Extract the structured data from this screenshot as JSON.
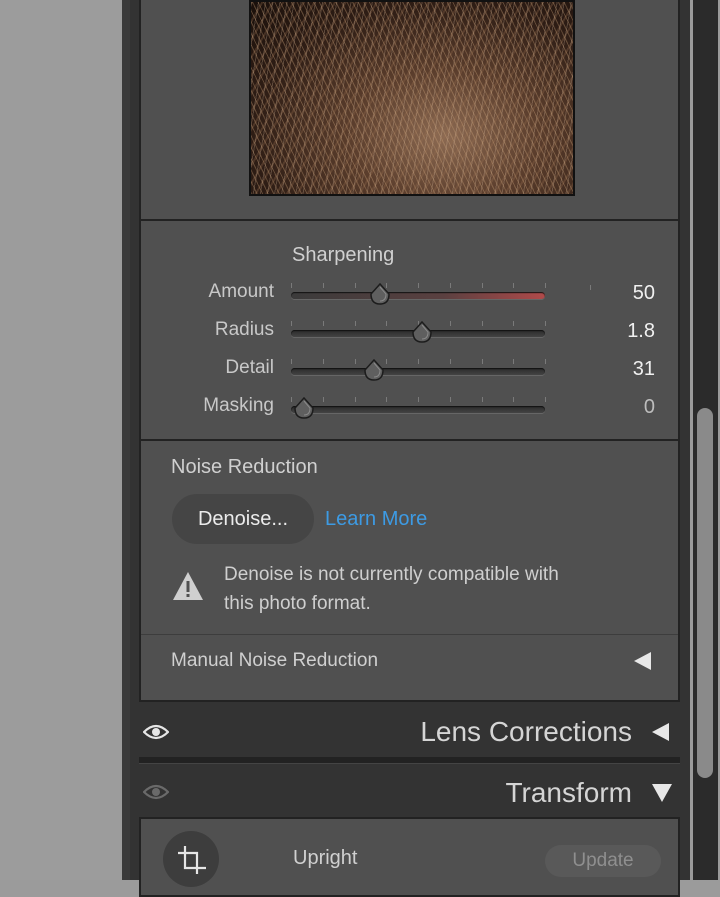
{
  "detail": {
    "sharpening": {
      "title": "Sharpening",
      "sliders": [
        {
          "label": "Amount",
          "value": "50",
          "fraction": 0.35
        },
        {
          "label": "Radius",
          "value": "1.8",
          "fraction": 0.52
        },
        {
          "label": "Detail",
          "value": "31",
          "fraction": 0.33
        },
        {
          "label": "Masking",
          "value": "0",
          "fraction": 0.0
        }
      ]
    },
    "noise_reduction": {
      "title": "Noise Reduction",
      "denoise_button": "Denoise...",
      "learn_more_link": "Learn More",
      "warning_icon": "warning-icon",
      "warning_text_line1": "Denoise is not currently compatible with",
      "warning_text_line2": "this photo format.",
      "manual_label": "Manual Noise Reduction"
    }
  },
  "lens_corrections": {
    "title": "Lens Corrections",
    "eye_icon": "eye-icon"
  },
  "transform": {
    "title": "Transform",
    "eye_icon": "eye-icon",
    "crop_icon": "crop-upright-icon",
    "upright_label": "Upright",
    "update_button": "Update"
  },
  "colors": {
    "accent_link": "#3d9be4",
    "panel": "#505050",
    "header": "#333333"
  }
}
